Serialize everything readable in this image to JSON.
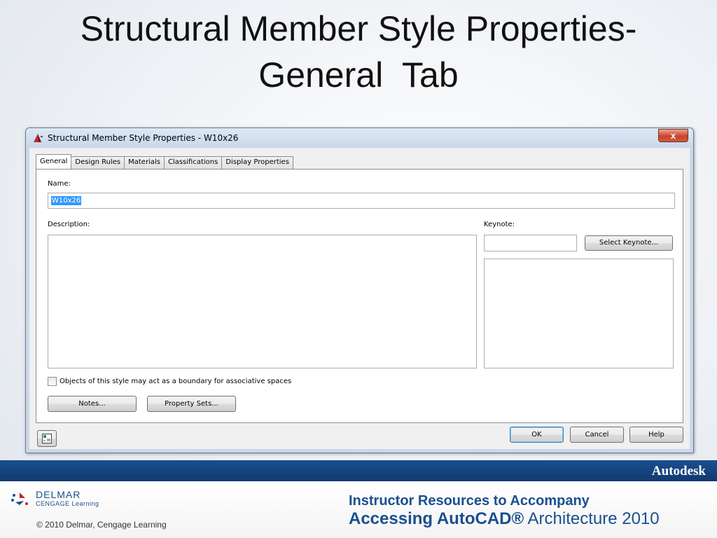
{
  "slide": {
    "title_line1": "Structural Member Style Properties-",
    "title_line2": "General  Tab"
  },
  "window": {
    "title": "Structural Member Style Properties - W10x26",
    "close_label": "x",
    "app_icon": "autocad-app-icon"
  },
  "tabs": [
    {
      "label": "General",
      "active": true
    },
    {
      "label": "Design Rules",
      "active": false
    },
    {
      "label": "Materials",
      "active": false
    },
    {
      "label": "Classifications",
      "active": false
    },
    {
      "label": "Display Properties",
      "active": false
    }
  ],
  "general": {
    "name_label": "Name:",
    "name_value": "W10x26",
    "description_label": "Description:",
    "description_value": "",
    "keynote_label": "Keynote:",
    "keynote_value": "",
    "select_keynote_label": "Select Keynote...",
    "boundary_checkbox_label": "Objects of this style may act as a boundary for associative spaces",
    "boundary_checked": false,
    "notes_label": "Notes...",
    "property_sets_label": "Property Sets..."
  },
  "buttons": {
    "ok": "OK",
    "cancel": "Cancel",
    "help": "Help",
    "bottom_left_icon": "style-manager-icon"
  },
  "footer": {
    "autodesk": "Autodesk",
    "delmar_name": "DELMAR",
    "delmar_sub": "CENGAGE Learning",
    "copyright": "© 2010  Delmar, Cengage Learning",
    "instructor": "Instructor Resources to Accompany",
    "accessing_bold": "Accessing AutoCAD®",
    "accessing_rest": " Architecture 2010"
  },
  "colors": {
    "brand_blue": "#1b4f8f",
    "selection": "#3399ff",
    "close_red": "#c8442c"
  }
}
